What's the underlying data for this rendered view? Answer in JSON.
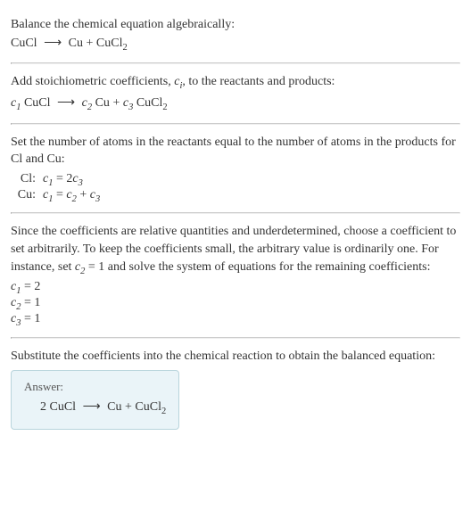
{
  "sections": {
    "s1": {
      "instruction": "Balance the chemical equation algebraically:",
      "equation_lhs": "CuCl",
      "equation_rhs_a": "Cu",
      "equation_rhs_b": "CuCl"
    },
    "s2": {
      "instruction_a": "Add stoichiometric coefficients, ",
      "coef_symbol": "c",
      "coef_sub": "i",
      "instruction_b": ", to the reactants and products:",
      "c1": "c",
      "c1_sub": "1",
      "t1": " CuCl",
      "c2": "c",
      "c2_sub": "2",
      "t2": " Cu",
      "c3": "c",
      "c3_sub": "3",
      "t3": " CuCl"
    },
    "s3": {
      "instruction": "Set the number of atoms in the reactants equal to the number of atoms in the products for Cl and Cu:",
      "atoms": [
        {
          "label": "Cl:",
          "lhs_c": "c",
          "lhs_sub": "1",
          "eq": " = 2",
          "rhs_c": "c",
          "rhs_sub": "3",
          "tail": ""
        },
        {
          "label": "Cu:",
          "lhs_c": "c",
          "lhs_sub": "1",
          "eq": " = ",
          "rhs_c": "c",
          "rhs_sub": "2",
          "tail_plus": " + ",
          "rhs2_c": "c",
          "rhs2_sub": "3"
        }
      ]
    },
    "s4": {
      "instruction_a": "Since the coefficients are relative quantities and underdetermined, choose a coefficient to set arbitrarily. To keep the coefficients small, the arbitrary value is ordinarily one. For instance, set ",
      "set_c": "c",
      "set_sub": "2",
      "set_val": " = 1",
      "instruction_b": " and solve the system of equations for the remaining coefficients:",
      "results": [
        {
          "c": "c",
          "sub": "1",
          "val": " = 2"
        },
        {
          "c": "c",
          "sub": "2",
          "val": " = 1"
        },
        {
          "c": "c",
          "sub": "3",
          "val": " = 1"
        }
      ]
    },
    "s5": {
      "instruction": "Substitute the coefficients into the chemical reaction to obtain the balanced equation:",
      "answer_label": "Answer:",
      "answer_lhs": "2 CuCl",
      "answer_rhs_a": "Cu",
      "answer_rhs_b": "CuCl"
    }
  },
  "chart_data": {
    "type": "table",
    "title": "Balanced chemical equation coefficients",
    "unbalanced_equation": "CuCl -> Cu + CuCl2",
    "balanced_equation": "2 CuCl -> Cu + CuCl2",
    "stoichiometric_form": "c1 CuCl -> c2 Cu + c3 CuCl2",
    "atom_balance": [
      {
        "element": "Cl",
        "equation": "c1 = 2 c3"
      },
      {
        "element": "Cu",
        "equation": "c1 = c2 + c3"
      }
    ],
    "coefficients": [
      {
        "name": "c1",
        "value": 2
      },
      {
        "name": "c2",
        "value": 1
      },
      {
        "name": "c3",
        "value": 1
      }
    ]
  }
}
